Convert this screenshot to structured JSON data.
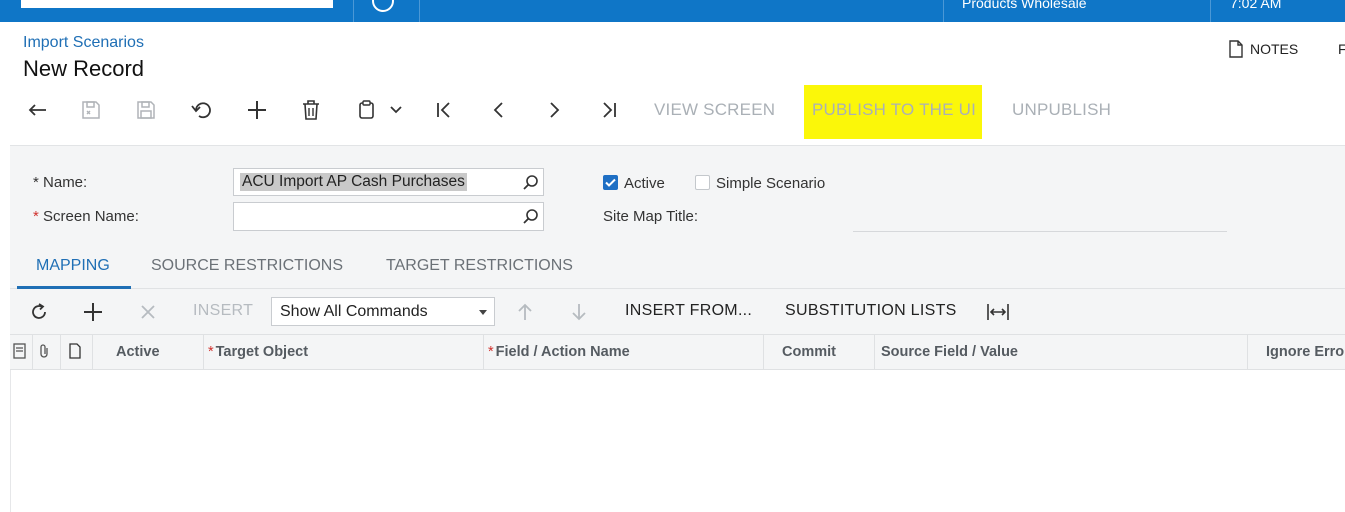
{
  "topbar": {
    "company": "Products Wholesale",
    "time": "7:02 AM"
  },
  "header": {
    "breadcrumb": "Import Scenarios",
    "title": "New Record",
    "notes_label": "NOTES",
    "next_label_cut": "F"
  },
  "toolbar": {
    "view_screen": "VIEW SCREEN",
    "publish": "PUBLISH TO THE UI",
    "unpublish": "UNPUBLISH",
    "highlight_color": "#fbf709"
  },
  "form": {
    "name_label": "Name:",
    "name_value": "ACU Import AP Cash Purchases",
    "screen_name_label": "Screen Name:",
    "screen_name_value": "",
    "active_label": "Active",
    "active_checked": true,
    "simple_scenario_label": "Simple Scenario",
    "simple_scenario_checked": false,
    "site_map_title_label": "Site Map Title:"
  },
  "tabs": [
    {
      "label": "MAPPING",
      "active": true
    },
    {
      "label": "SOURCE RESTRICTIONS",
      "active": false
    },
    {
      "label": "TARGET RESTRICTIONS",
      "active": false
    }
  ],
  "grid_toolbar": {
    "insert": "INSERT",
    "command_filter": "Show All Commands",
    "insert_from": "INSERT FROM...",
    "substitution_lists": "SUBSTITUTION LISTS"
  },
  "grid": {
    "columns": [
      "Active",
      "Target Object",
      "Field / Action Name",
      "Commit",
      "Source Field / Value",
      "Ignore Erro"
    ]
  },
  "colors": {
    "accent": "#0f76c7",
    "link": "#1f6fb5",
    "required": "#d0312d"
  }
}
